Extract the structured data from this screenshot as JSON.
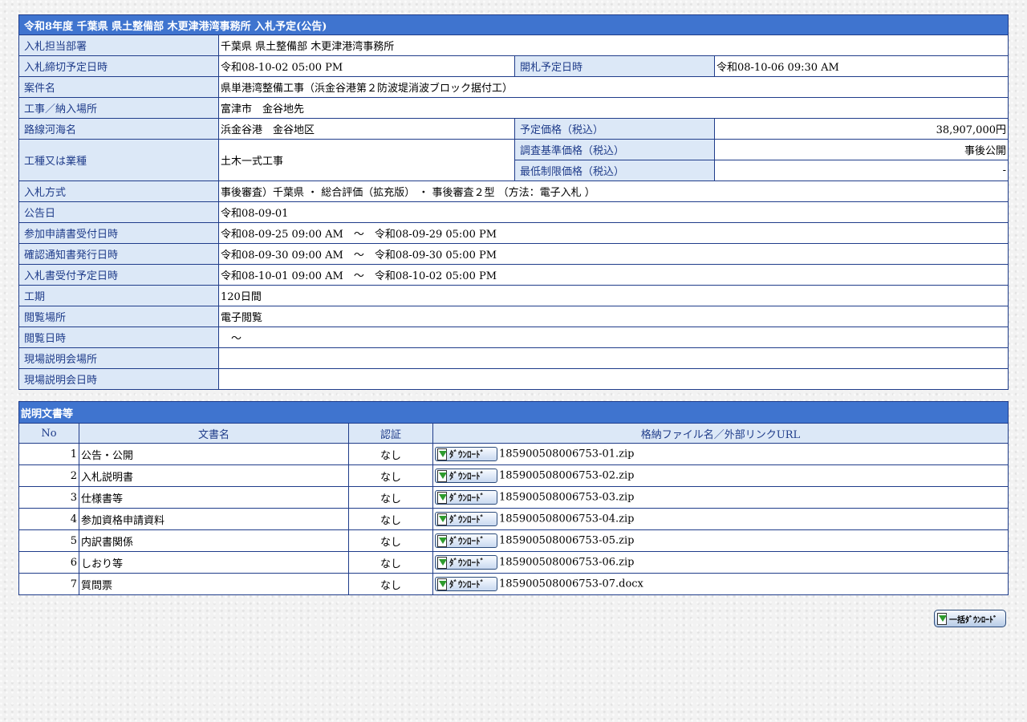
{
  "title": "令和8年度 千葉県 県土整備部 木更津港湾事務所 入札予定(公告)",
  "info": {
    "dept_label": "入札担当部署",
    "dept": "千葉県 県土整備部 木更津港湾事務所",
    "deadline_label": "入札締切予定日時",
    "deadline": "令和08-10-02 05:00 PM",
    "opening_label": "開札予定日時",
    "opening": "令和08-10-06 09:30 AM",
    "case_label": "案件名",
    "case": "県単港湾整備工事（浜金谷港第２防波堤消波ブロック据付工）",
    "place_label": "工事／納入場所",
    "place": "富津市　金谷地先",
    "route_label": "路線河海名",
    "route": "浜金谷港　金谷地区",
    "price_label": "予定価格（税込）",
    "price": "38,907,000円",
    "type_label": "工種又は業種",
    "type": "土木一式工事",
    "survey_label": "調査基準価格（税込）",
    "survey": "事後公開",
    "min_label": "最低制限価格（税込）",
    "min": "-",
    "method_label": "入札方式",
    "method": "事後審査）千葉県 ・ 総合評価（拡充版） ・ 事後審査２型 （方法：電子入札 ）",
    "notice_label": "公告日",
    "notice": "令和08-09-01",
    "apply_label": "参加申請書受付日時",
    "apply": "令和08-09-25 09:00 AM　～　令和08-09-29 05:00 PM",
    "confirm_label": "確認通知書発行日時",
    "confirm": "令和08-09-30 09:00 AM　～　令和08-09-30 05:00 PM",
    "bidrecv_label": "入札書受付予定日時",
    "bidrecv": "令和08-10-01 09:00 AM　～　令和08-10-02 05:00 PM",
    "period_label": "工期",
    "period": "120日間",
    "view_place_label": "閲覧場所",
    "view_place": "電子閲覧",
    "view_date_label": "閲覧日時",
    "view_date": "　～",
    "site_place_label": "現場説明会場所",
    "site_place": "",
    "site_date_label": "現場説明会日時",
    "site_date": ""
  },
  "docs": {
    "title": "説明文書等",
    "headers": [
      "No",
      "文書名",
      "認証",
      "格納ファイル名／外部リンクURL"
    ],
    "download_label": "ﾀﾞｳﾝﾛｰﾄﾞ",
    "rows": [
      {
        "no": "1",
        "name": "公告・公開",
        "auth": "なし",
        "file": "185900508006753-01.zip"
      },
      {
        "no": "2",
        "name": "入札説明書",
        "auth": "なし",
        "file": "185900508006753-02.zip"
      },
      {
        "no": "3",
        "name": "仕様書等",
        "auth": "なし",
        "file": "185900508006753-03.zip"
      },
      {
        "no": "4",
        "name": "参加資格申請資料",
        "auth": "なし",
        "file": "185900508006753-04.zip"
      },
      {
        "no": "5",
        "name": "内訳書関係",
        "auth": "なし",
        "file": "185900508006753-05.zip"
      },
      {
        "no": "6",
        "name": "しおり等",
        "auth": "なし",
        "file": "185900508006753-06.zip"
      },
      {
        "no": "7",
        "name": "質問票",
        "auth": "なし",
        "file": "185900508006753-07.docx"
      }
    ]
  },
  "bulk_label": "一括ﾀﾞｳﾝﾛｰﾄﾞ"
}
